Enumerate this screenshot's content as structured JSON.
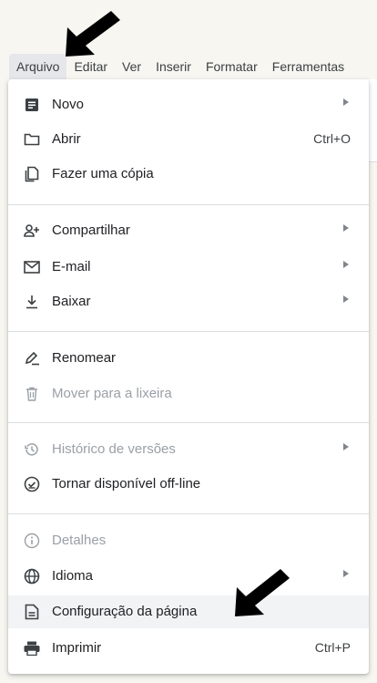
{
  "menubar": {
    "items": [
      "Arquivo",
      "Editar",
      "Ver",
      "Inserir",
      "Formatar",
      "Ferramentas"
    ]
  },
  "file_menu": {
    "items": [
      {
        "label": "Novo",
        "icon": "document-icon",
        "submenu": true
      },
      {
        "label": "Abrir",
        "icon": "folder-icon",
        "shortcut": "Ctrl+O"
      },
      {
        "label": "Fazer uma cópia",
        "icon": "copy-icon"
      },
      {
        "label": "Compartilhar",
        "icon": "person-add-icon",
        "submenu": true
      },
      {
        "label": "E-mail",
        "icon": "envelope-icon",
        "submenu": true
      },
      {
        "label": "Baixar",
        "icon": "download-icon",
        "submenu": true
      },
      {
        "label": "Renomear",
        "icon": "pencil-icon"
      },
      {
        "label": "Mover para a lixeira",
        "icon": "trash-icon",
        "disabled": true
      },
      {
        "label": "Histórico de versões",
        "icon": "history-icon",
        "submenu": true,
        "disabled": true
      },
      {
        "label": "Tornar disponível off-line",
        "icon": "offline-check-icon"
      },
      {
        "label": "Detalhes",
        "icon": "info-icon",
        "disabled": true
      },
      {
        "label": "Idioma",
        "icon": "globe-icon",
        "submenu": true
      },
      {
        "label": "Configuração da página",
        "icon": "page-setup-icon",
        "highlighted": true
      },
      {
        "label": "Imprimir",
        "icon": "printer-icon",
        "shortcut": "Ctrl+P"
      }
    ]
  },
  "colors": {
    "page_background": "#f7f6f1",
    "menu_background": "#ffffff",
    "highlight": "#f1f3f4",
    "disabled_text": "#9aa0a6",
    "annotation_arrow": "#000000"
  }
}
